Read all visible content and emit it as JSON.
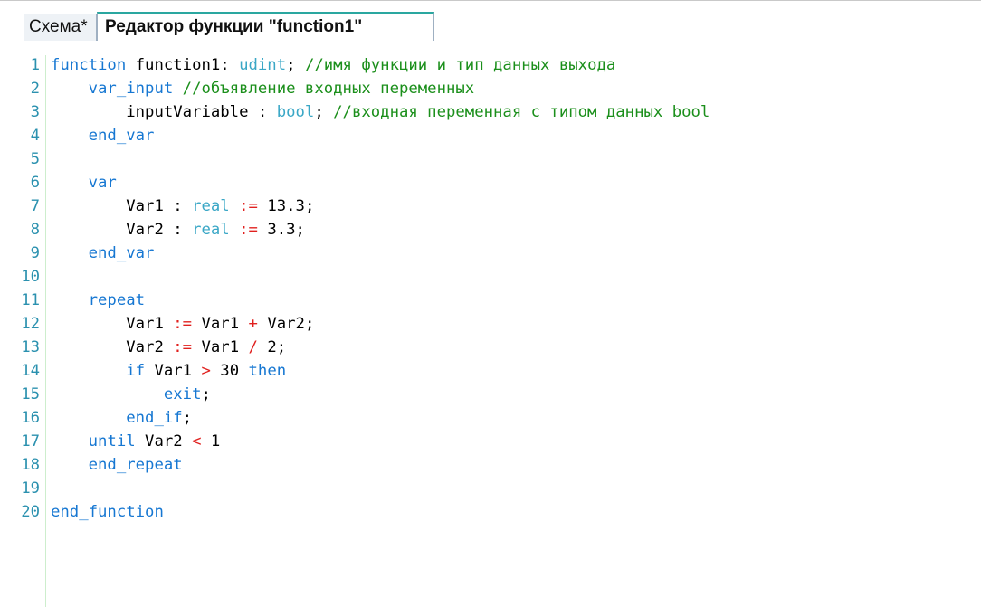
{
  "tabs": [
    {
      "label": "Схема*",
      "active": false
    },
    {
      "label": "Редактор функции \"function1\"",
      "active": true
    }
  ],
  "editor": {
    "lines": [
      {
        "n": "1",
        "t": "function function1: udint; //имя функции и тип данных выхода"
      },
      {
        "n": "2",
        "t": "    var_input //объявление входных переменных"
      },
      {
        "n": "3",
        "t": "        inputVariable : bool; //входная переменная с типом данных bool"
      },
      {
        "n": "4",
        "t": "    end_var"
      },
      {
        "n": "5",
        "t": ""
      },
      {
        "n": "6",
        "t": "    var"
      },
      {
        "n": "7",
        "t": "        Var1 : real := 13.3;"
      },
      {
        "n": "8",
        "t": "        Var2 : real := 3.3;"
      },
      {
        "n": "9",
        "t": "    end_var"
      },
      {
        "n": "10",
        "t": ""
      },
      {
        "n": "11",
        "t": "    repeat"
      },
      {
        "n": "12",
        "t": "        Var1 := Var1 + Var2;"
      },
      {
        "n": "13",
        "t": "        Var2 := Var1 / 2;"
      },
      {
        "n": "14",
        "t": "        if Var1 > 30 then"
      },
      {
        "n": "15",
        "t": "            exit;"
      },
      {
        "n": "16",
        "t": "        end_if;"
      },
      {
        "n": "17",
        "t": "    until Var2 < 1"
      },
      {
        "n": "18",
        "t": "    end_repeat"
      },
      {
        "n": "19",
        "t": ""
      },
      {
        "n": "20",
        "t": "end_function"
      }
    ]
  },
  "colors": {
    "keyword": "#1677d2",
    "type": "#3aa7c6",
    "comment": "#1b8f1b",
    "operator": "#e0201e",
    "line_number": "#2b91af",
    "active_tab_accent": "#2aa7a0"
  }
}
